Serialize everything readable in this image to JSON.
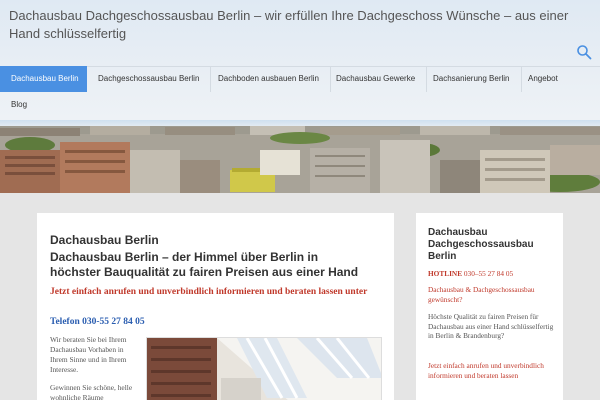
{
  "site": {
    "title": "Dachausbau Dachgeschossausbau Berlin – wir erfüllen Ihre Dachgeschoss Wünsche – aus einer Hand schlüsselfertig"
  },
  "nav": {
    "items": [
      {
        "label": "Dachausbau Berlin",
        "active": true
      },
      {
        "label": "Dachgeschossausbau Berlin",
        "active": false
      },
      {
        "label": "Dachboden ausbauen Berlin",
        "active": false
      },
      {
        "label": "Dachausbau Gewerke",
        "active": false
      },
      {
        "label": "Dachsanierung Berlin",
        "active": false
      },
      {
        "label": "Angebot",
        "active": false
      },
      {
        "label": "Blog",
        "active": false
      }
    ]
  },
  "icons": {
    "search": "search-icon"
  },
  "colors": {
    "accent": "#4a90e2",
    "cta_red": "#c0392b",
    "phone_blue": "#2a5db0"
  },
  "main": {
    "page_title": "Dachausbau Berlin",
    "intro_heading": "Dachausbau Berlin – der Himmel über Berlin in höchster Bauqualität zu fairen Preisen aus einer Hand",
    "cta": "Jetzt einfach anrufen und unverbindlich informieren und beraten lassen unter",
    "phone_label": "Telefon",
    "phone_number": "030-55 27 84 05",
    "body_p1": "Wir beraten Sie bei Ihrem Dachausbau Vorhaben in Ihrem Sinne und in Ihrem Interesse.",
    "body_p2": "Gewinnen Sie schöne, helle wohnliche Räume"
  },
  "sidebar": {
    "title": "Dachausbau Dachgeschossausbau Berlin",
    "hotline_label": "HOTLINE",
    "hotline_number": "030–55 27 84 05",
    "question": "Dachausbau & Dachgeschossausbau gewünscht?",
    "paragraph": "Höchste Qualität zu fairen Preisen für Dachausbau aus einer Hand schlüsselfertig in Berlin & Brandenburg?",
    "call_to_action": "Jetzt einfach anrufen und unverbindlich informieren und beraten lassen"
  }
}
